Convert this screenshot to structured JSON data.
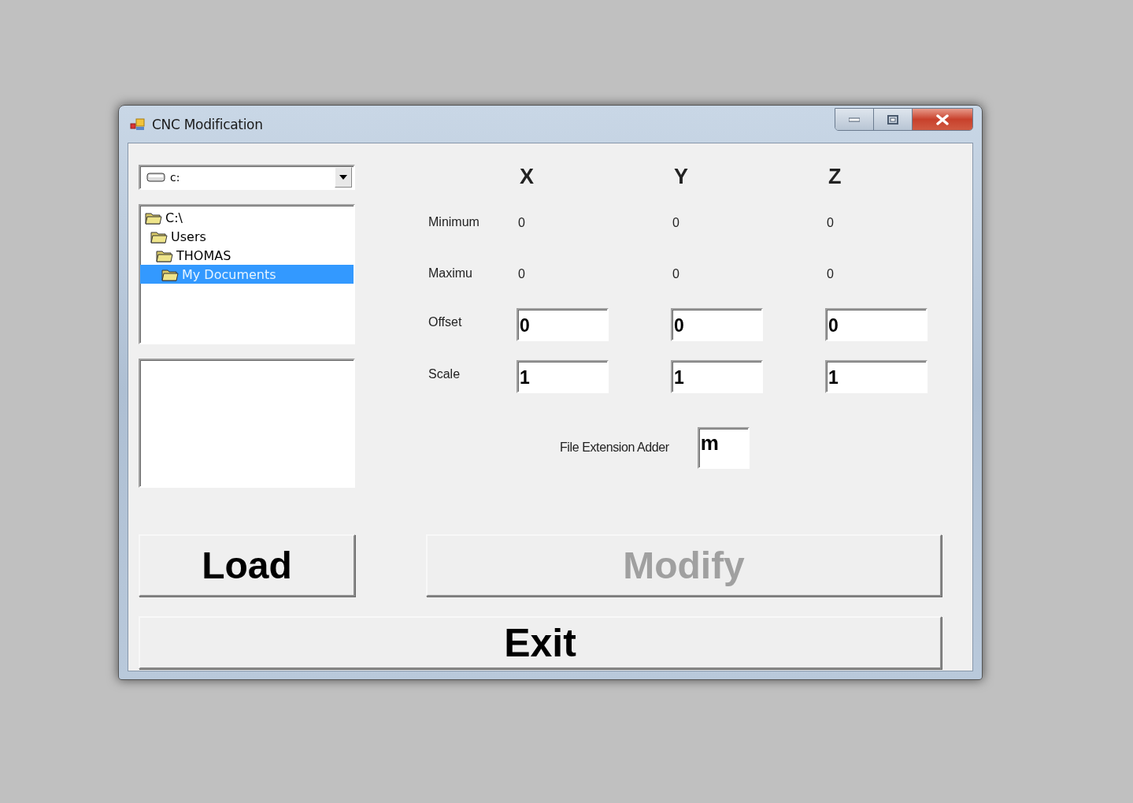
{
  "window": {
    "title": "CNC Modification"
  },
  "drive_combo": {
    "value": "c:"
  },
  "folder_tree": [
    {
      "label": "C:\\",
      "selected": false,
      "children": [
        {
          "label": "Users",
          "selected": false,
          "children": [
            {
              "label": "THOMAS",
              "selected": false,
              "children": [
                {
                  "label": "My Documents",
                  "selected": true
                }
              ]
            }
          ]
        }
      ]
    }
  ],
  "axes": {
    "headers": [
      "X",
      "Y",
      "Z"
    ],
    "rows": [
      {
        "label": "Minimum",
        "kind": "readout",
        "values": [
          "0",
          "0",
          "0"
        ]
      },
      {
        "label": "Maximu",
        "kind": "readout",
        "values": [
          "0",
          "0",
          "0"
        ]
      },
      {
        "label": "Offset",
        "kind": "input",
        "values": [
          "0",
          "0",
          "0"
        ]
      },
      {
        "label": "Scale",
        "kind": "input",
        "values": [
          "1",
          "1",
          "1"
        ]
      }
    ]
  },
  "file_extension_adder": {
    "label": "File Extension Adder",
    "value": "m"
  },
  "buttons": [
    {
      "label": "Load",
      "disabled": false
    },
    {
      "label": "Modify",
      "disabled": true
    },
    {
      "label": "Exit",
      "disabled": false
    }
  ]
}
